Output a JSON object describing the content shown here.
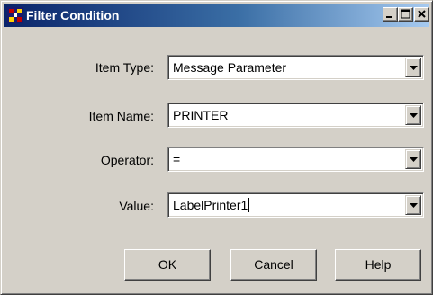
{
  "window": {
    "title": "Filter Condition",
    "app_icon": "filter-app-icon",
    "controls": [
      "minimize-icon",
      "maximize-icon",
      "close-icon"
    ]
  },
  "fields": {
    "item_type": {
      "label": "Item Type:",
      "value": "Message Parameter"
    },
    "item_name": {
      "label": "Item Name:",
      "value": "PRINTER"
    },
    "operator": {
      "label": "Operator:",
      "value": "="
    },
    "value": {
      "label": "Value:",
      "value": "LabelPrinter1"
    }
  },
  "buttons": {
    "ok": "OK",
    "cancel": "Cancel",
    "help": "Help"
  },
  "colors": {
    "title_bar_start": "#0a246a",
    "title_bar_end": "#a6caf0",
    "face": "#d4d0c8"
  }
}
